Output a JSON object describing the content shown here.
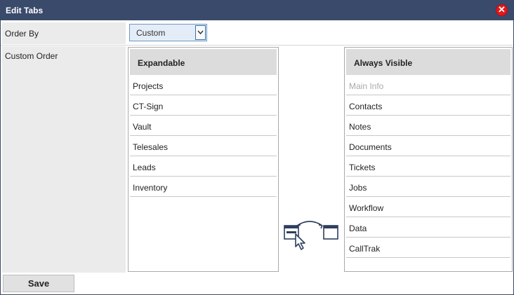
{
  "window": {
    "title": "Edit Tabs",
    "close_icon": "close-icon",
    "accent": "#e4171b",
    "titlebar_color": "#3a4a6b"
  },
  "form": {
    "order_by_label": "Order By",
    "order_by_value": "Custom",
    "custom_order_label": "Custom Order"
  },
  "expandable": {
    "heading": "Expandable",
    "items": [
      "Projects",
      "CT-Sign",
      "Vault",
      "Telesales",
      "Leads",
      "Inventory"
    ]
  },
  "always_visible": {
    "heading": "Always Visible",
    "disabled_item": "Main Info",
    "items": [
      "Contacts",
      "Notes",
      "Documents",
      "Tickets",
      "Jobs",
      "Workflow",
      "Data",
      "CallTrak"
    ]
  },
  "swap_icon": "drag-swap-icon",
  "footer": {
    "save_label": "Save"
  }
}
